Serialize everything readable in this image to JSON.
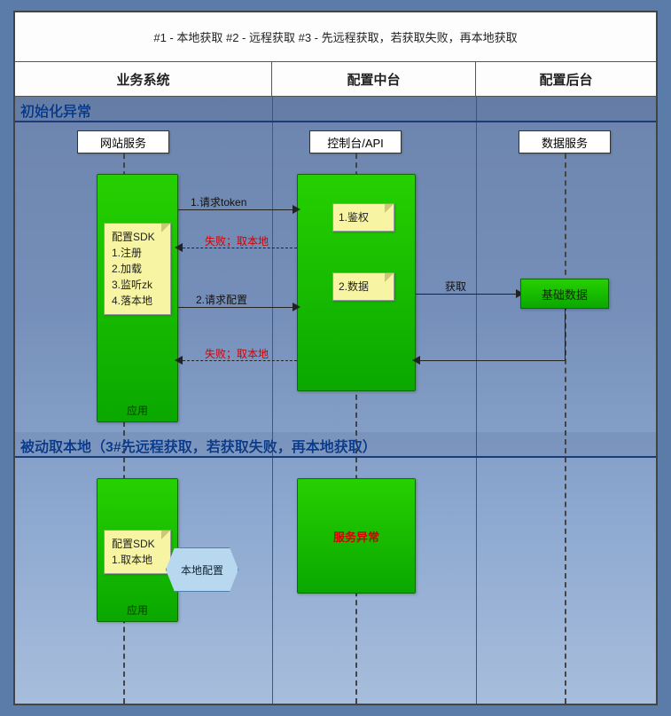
{
  "title": "#1 - 本地获取 #2 - 远程获取 #3 - 先远程获取，若获取失败，再本地获取",
  "lanes": {
    "c1": "业务系统",
    "c2": "配置中台",
    "c3": "配置后台"
  },
  "lifelines": {
    "web": "网站服务",
    "console": "控制台/API",
    "data": "数据服务"
  },
  "sections": {
    "s1": "初始化异常",
    "s2": "被动取本地（3#先远程获取，若获取失败，再本地获取）"
  },
  "notes": {
    "sdk1_title": "配置SDK",
    "sdk1_items": [
      "1.注册",
      "2.加载",
      "3.监听zk",
      "4.落本地"
    ],
    "auth": "1.鉴权",
    "datastep": "2.数据",
    "sdk2_title": "配置SDK",
    "sdk2_items": [
      "1.取本地"
    ]
  },
  "arrows": {
    "a1": "1.请求token",
    "a1_fail": "失败；取本地",
    "a2": "2.请求配置",
    "a2_get": "获取",
    "a2_fail": "失败；取本地"
  },
  "labels": {
    "app": "应用",
    "basedata": "基础数据",
    "localcfg": "本地配置",
    "svc_err": "服务异常"
  }
}
